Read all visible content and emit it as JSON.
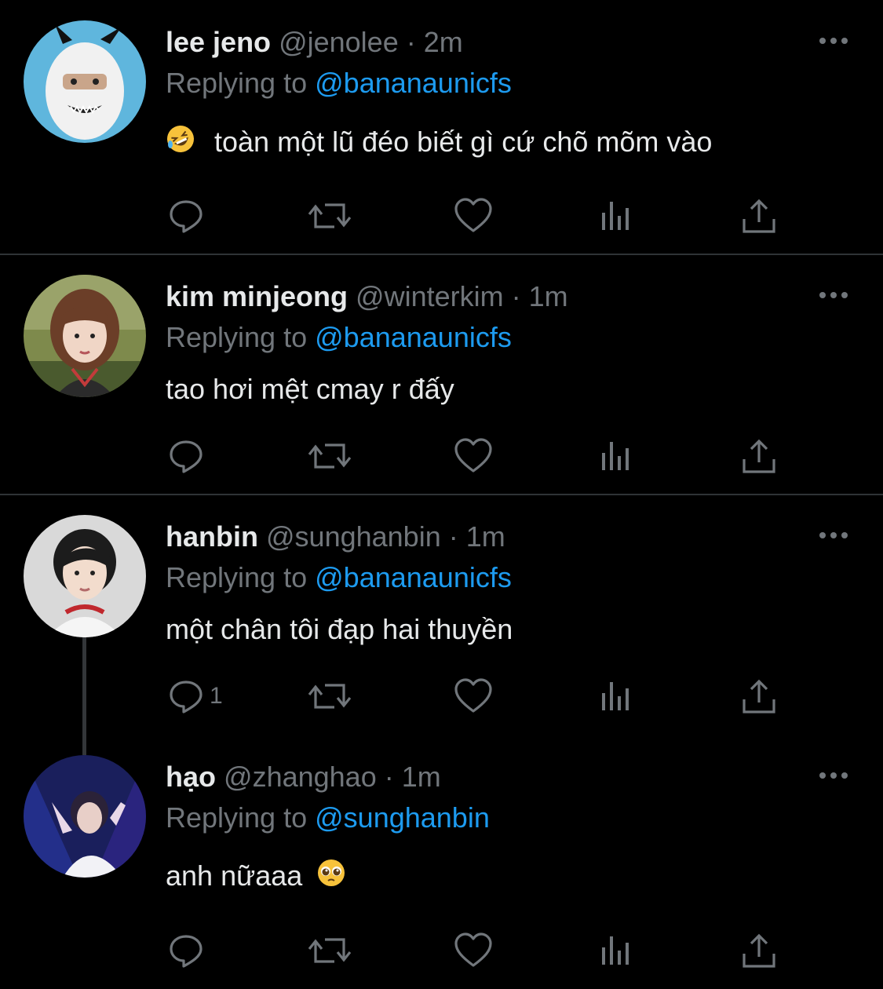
{
  "colors": {
    "background": "#000000",
    "primary_text": "#e7e9ea",
    "secondary_text": "#71767b",
    "link": "#1d9bf0",
    "divider": "#2f3336"
  },
  "tweets": [
    {
      "name": "lee jeno",
      "handle": "@jenolee",
      "time": "· 2m",
      "replying_label": "Replying to",
      "replying_to": "@bananaunicfs",
      "leading_emoji": "rolling-on-floor-laughing-emoji",
      "text": "toàn một lũ đéo biết gì cứ chõ mõm vào",
      "reply_count": ""
    },
    {
      "name": "kim minjeong",
      "handle": "@winterkim",
      "time": "· 1m",
      "replying_label": "Replying to",
      "replying_to": "@bananaunicfs",
      "text": "tao hơi mệt cmay r đấy",
      "reply_count": ""
    },
    {
      "name": "hanbin",
      "handle": "@sunghanbin",
      "time": "· 1m",
      "replying_label": "Replying to",
      "replying_to": "@bananaunicfs",
      "text": "một chân tôi đạp hai thuyền",
      "reply_count": "1"
    },
    {
      "name": "hạo",
      "handle": "@zhanghao",
      "time": "· 1m",
      "replying_label": "Replying to",
      "replying_to": "@sunghanbin",
      "text": "anh nữaaa",
      "trailing_emoji": "pleading-face-emoji",
      "reply_count": ""
    }
  ],
  "action_icons": [
    "reply-icon",
    "retweet-icon",
    "like-icon",
    "views-icon",
    "share-icon"
  ]
}
